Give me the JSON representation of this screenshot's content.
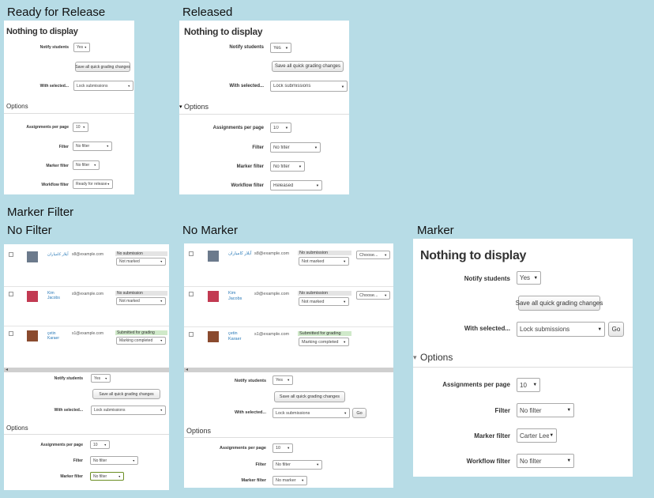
{
  "captions": {
    "ready": "Ready for Release",
    "released": "Released",
    "marker_filter": "Marker Filter",
    "no_filter": "No Filter",
    "no_marker": "No Marker",
    "marker": "Marker"
  },
  "common": {
    "nothing": "Nothing to display",
    "notify_label": "Notify students",
    "notify_value": "Yes",
    "save_btn": "Save all quick grading changes",
    "with_selected_label": "With selected...",
    "with_selected_value": "Lock submissions",
    "options": "Options",
    "per_page_label": "Assignments per page",
    "per_page_value": "10",
    "filter_label": "Filter",
    "filter_value": "No filter",
    "marker_label": "Marker filter",
    "workflow_label": "Workflow filter",
    "go": "Go"
  },
  "ready": {
    "marker_value": "No filter",
    "workflow_value": "Ready for release"
  },
  "released": {
    "marker_value": "No filter",
    "workflow_value": "Released"
  },
  "marker": {
    "marker_value": "Carter Lee",
    "workflow_value": "No filter"
  },
  "no_filter": {
    "marker_value": "No filter"
  },
  "no_marker": {
    "marker_value": "No marker"
  },
  "students": [
    {
      "name": "آیلار کامیاران",
      "email": "s8@example.com",
      "status": "No submission",
      "marking": "Not marked",
      "status_color": "#e4e4e4"
    },
    {
      "name": "Kim Jacobs",
      "email": "s9@example.com",
      "status": "No submission",
      "marking": "Not marked",
      "status_color": "#e4e4e4"
    },
    {
      "name": "çetin Karaer",
      "email": "s1@example.com",
      "status": "Submitted for grading",
      "marking": "Marking completed",
      "status_color": "#cfe9c9"
    }
  ],
  "choose": "Choose...",
  "icons": {
    "dropdown": "▼",
    "collapse": "▾",
    "scroll_left": "◂"
  }
}
